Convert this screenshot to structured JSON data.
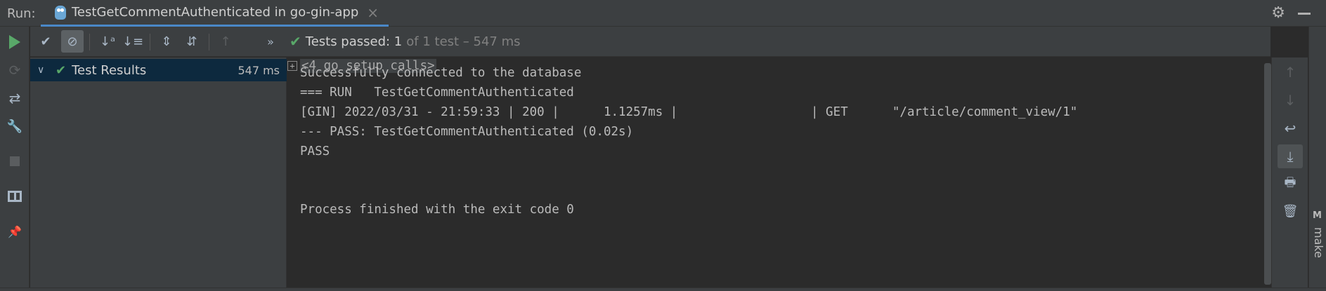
{
  "header": {
    "run_label": "Run:",
    "tab_title": "TestGetCommentAuthenticated in go-gin-app",
    "close_glyph": "×",
    "gear_glyph": "⚙"
  },
  "left_toolbar": {
    "rerun_failed_glyph": "⟳",
    "toggle_glyph": "⇄",
    "settings_glyph": "🔧",
    "pin_glyph": "📌"
  },
  "test_toolbar": {
    "passed_check": "✔",
    "ignored": "⊘",
    "sort_alpha": "↓ᵃ",
    "sort_duration": "↓≡",
    "expand": "⇕",
    "collapse": "⇵",
    "prev": "↑",
    "more": "»"
  },
  "status": {
    "check": "✔",
    "passed_text": "Tests passed: 1",
    "detail": "of 1 test – 547 ms"
  },
  "tree": {
    "chevron": "∨",
    "check": "✔",
    "label": "Test Results",
    "duration": "547 ms"
  },
  "console": {
    "fold_plus": "+",
    "fold_text": "<4 go setup calls>",
    "lines": [
      "Successfully connected to the database",
      "=== RUN   TestGetCommentAuthenticated",
      "[GIN] 2022/03/31 - 21:59:33 | 200 |      1.1257ms |                  | GET      \"/article/comment_view/1\"",
      "--- PASS: TestGetCommentAuthenticated (0.02s)",
      "PASS",
      "Process finished with the exit code 0"
    ]
  },
  "right_toolbar": {
    "up": "↑",
    "down": "↓",
    "wrap": "↩",
    "scroll_end": "⤓",
    "print": "🖶",
    "trash": "🗑"
  },
  "strip": {
    "make_icon": "M",
    "make_label": "make"
  },
  "colors": {
    "accent": "#4a88c7",
    "success": "#59a869",
    "background": "#2b2b2b",
    "panel": "#3c3f41",
    "selection": "#0d293e"
  }
}
